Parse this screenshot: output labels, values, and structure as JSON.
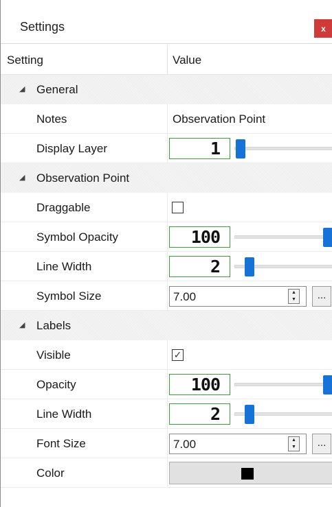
{
  "window": {
    "title": "Settings",
    "close_label": "x"
  },
  "header": {
    "setting": "Setting",
    "value": "Value"
  },
  "categories": {
    "general": "General",
    "observation_point": "Observation Point",
    "labels": "Labels"
  },
  "rows": {
    "notes": {
      "label": "Notes",
      "value": "Observation Point"
    },
    "display_layer": {
      "label": "Display Layer",
      "value": "1",
      "slider_fraction": 0.0
    },
    "draggable": {
      "label": "Draggable",
      "checked": false,
      "mark": ""
    },
    "symbol_opacity": {
      "label": "Symbol Opacity",
      "value": "100",
      "slider_fraction": 1.0
    },
    "obs_line_width": {
      "label": "Line Width",
      "value": "2",
      "slider_fraction": 0.1
    },
    "symbol_size": {
      "label": "Symbol Size",
      "value": "7.00",
      "spin_up": "▲",
      "spin_down": "▼",
      "ellipsis": "..."
    },
    "visible": {
      "label": "Visible",
      "checked": true,
      "mark": "✓"
    },
    "opacity": {
      "label": "Opacity",
      "value": "100",
      "slider_fraction": 1.0
    },
    "labels_line_width": {
      "label": "Line Width",
      "value": "2",
      "slider_fraction": 0.1
    },
    "font_size": {
      "label": "Font Size",
      "value": "7.00",
      "spin_up": "▲",
      "spin_down": "▼",
      "ellipsis": "..."
    },
    "color": {
      "label": "Color",
      "swatch_color": "#000000"
    }
  },
  "icons": {
    "collapse": "◢",
    "close": "close-icon"
  },
  "colors": {
    "accent": "#1672d6",
    "lcd_border": "#3f9a3f",
    "close_button": "#cf3a3a"
  }
}
